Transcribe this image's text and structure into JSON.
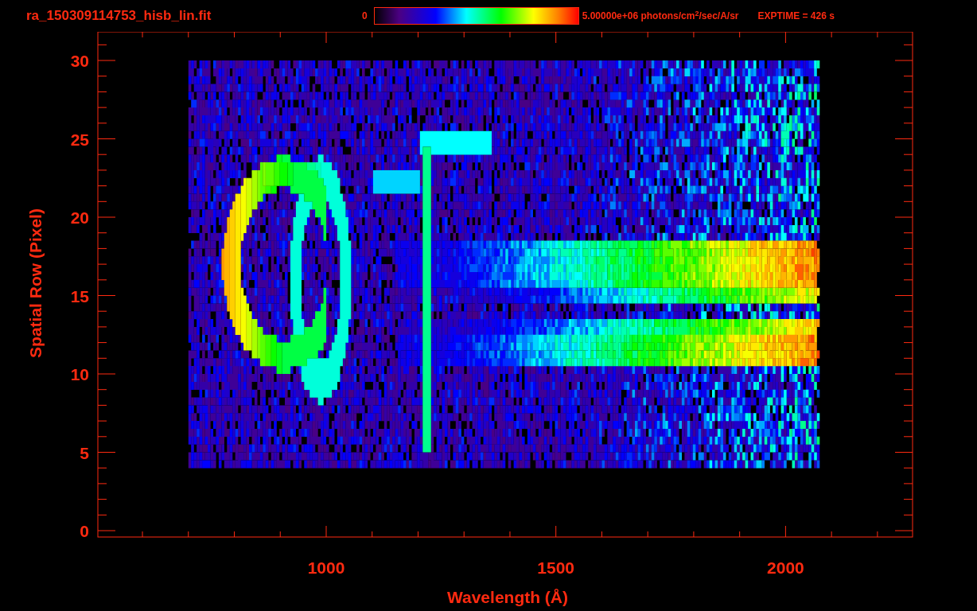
{
  "title": "ra_150309114753_hisb_lin.fit",
  "colorbar": {
    "min_label": "0",
    "max_label": "5.00000e+06 photons/cm$^{2}$/sec/A/sr"
  },
  "exposure": "EXPTIME = 426 s",
  "x_axis": {
    "label": "Wavelength (Å)",
    "ticks": [
      "1000",
      "1500",
      "2000"
    ]
  },
  "y_axis": {
    "label": "Spatial Row (Pixel)",
    "ticks": [
      "30",
      "25",
      "20",
      "15",
      "10",
      "5",
      "0"
    ]
  }
}
